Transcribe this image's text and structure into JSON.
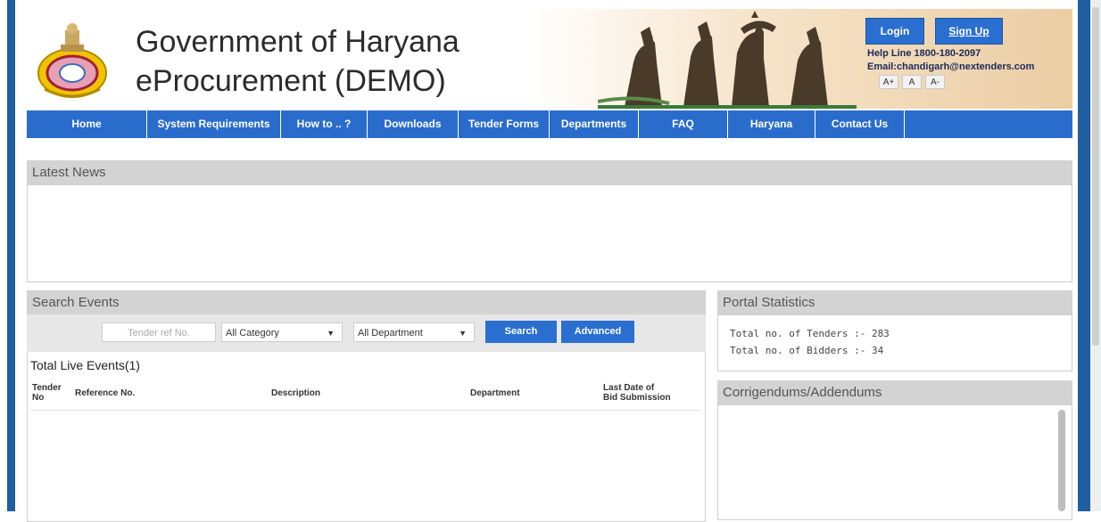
{
  "header": {
    "title_line1": "Government of Haryana",
    "title_line2": "eProcurement (DEMO)",
    "login_label": "Login",
    "signup_label": "Sign Up",
    "helpline": "Help Line 1800-180-2097",
    "email": "Email:chandigarh@nextenders.com",
    "font_sizes": [
      "A+",
      "A",
      "A-"
    ]
  },
  "nav": {
    "items": [
      "Home",
      "System Requirements",
      "How to .. ?",
      "Downloads",
      "Tender Forms",
      "Departments",
      "FAQ",
      "Haryana",
      "Contact Us"
    ]
  },
  "latest_news": {
    "title": "Latest News"
  },
  "search_events": {
    "title": "Search Events",
    "ref_placeholder": "Tender ref No.",
    "category_value": "All Category",
    "department_value": "All Department",
    "search_label": "Search",
    "advanced_label": "Advanced",
    "total_live": "Total Live Events(1)",
    "columns": {
      "tender_no": [
        "Tender",
        "No"
      ],
      "reference": "Reference No.",
      "description": "Description",
      "department": "Department",
      "last_date": [
        "Last Date of",
        "Bid Submission"
      ]
    }
  },
  "portal_stats": {
    "title": "Portal Statistics",
    "tenders": "Total no. of Tenders :- 283",
    "bidders": "Total no. of Bidders :- 34"
  },
  "corrigendums": {
    "title": "Corrigendums/Addendums"
  },
  "colors": {
    "nav_blue": "#2a6ccc",
    "button_blue": "#2a6fd0",
    "frame_blue": "#1f5fa0"
  }
}
